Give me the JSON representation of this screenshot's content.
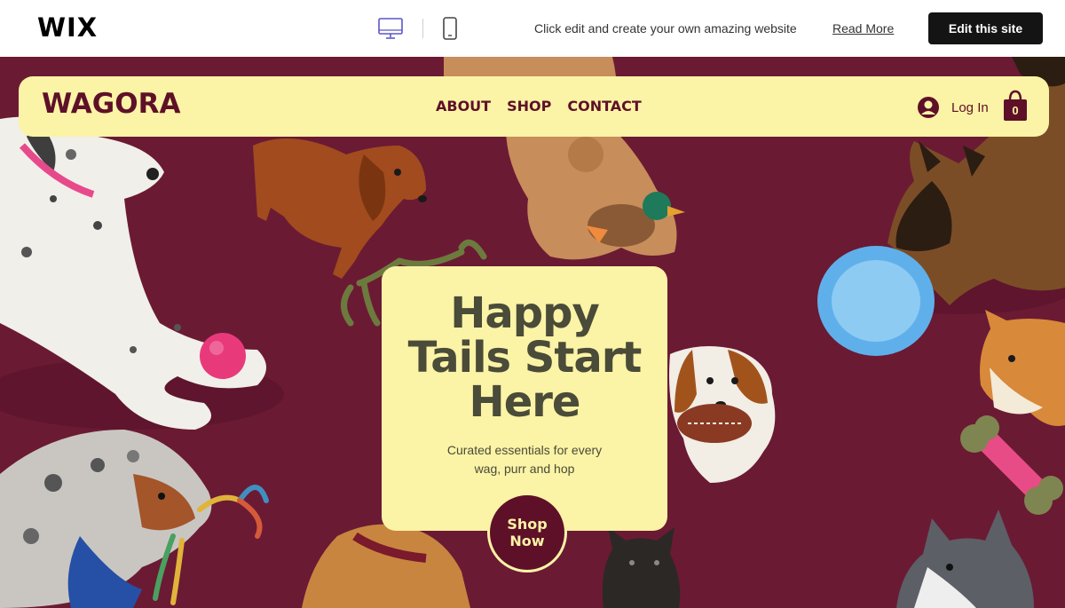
{
  "wix_bar": {
    "logo": "WIX",
    "promo_text": "Click edit and create your own amazing website",
    "read_more": "Read More",
    "edit_button": "Edit this site",
    "devices": [
      "desktop-icon",
      "mobile-icon"
    ]
  },
  "site": {
    "brand": "WAGORA",
    "nav": [
      "ABOUT",
      "SHOP",
      "CONTACT"
    ],
    "login_label": "Log In",
    "cart_count": "0",
    "colors": {
      "maroon": "#6b1a34",
      "brand_text": "#5e1028",
      "cream": "#fbf3a6",
      "headline": "#4a4b38"
    }
  },
  "hero": {
    "title_lines": [
      "Happy",
      "Tails Start",
      "Here"
    ],
    "subtitle_lines": [
      "Curated essentials for every",
      "wag, purr and hop"
    ],
    "cta_lines": [
      "Shop",
      "Now"
    ]
  }
}
